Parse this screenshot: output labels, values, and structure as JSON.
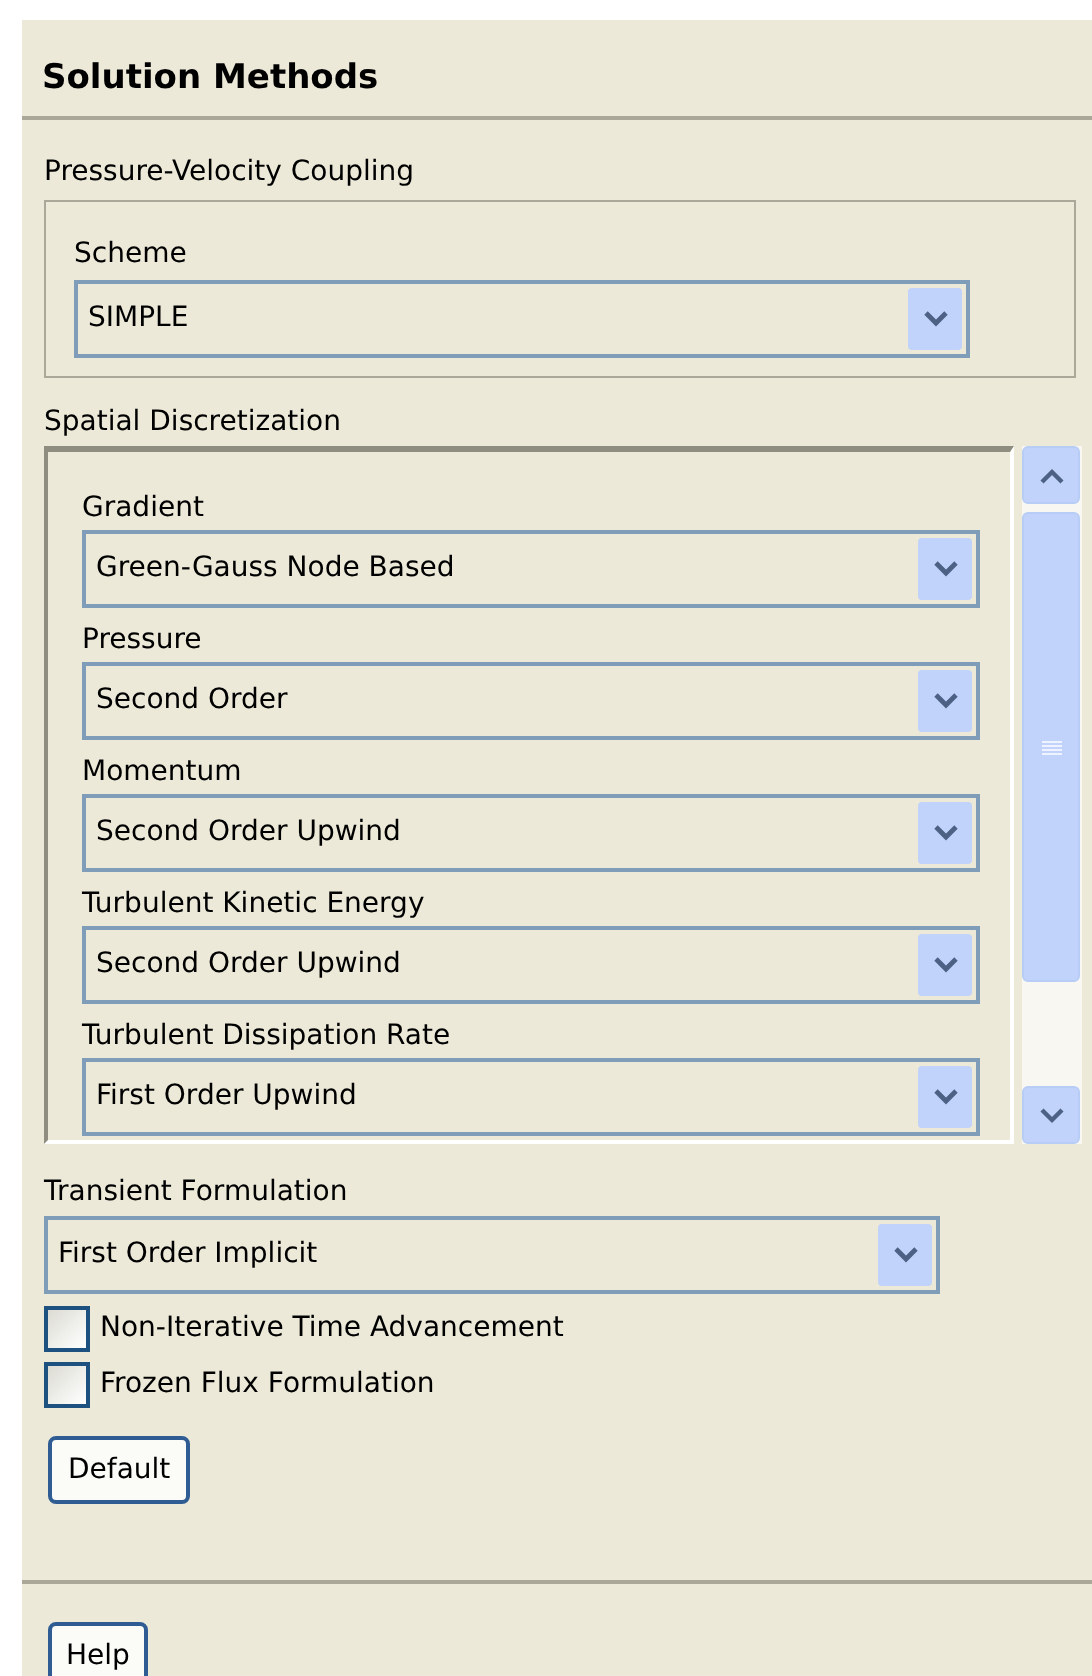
{
  "title": "Solution Methods",
  "pressure_velocity_coupling": {
    "label": "Pressure-Velocity Coupling",
    "scheme": {
      "label": "Scheme",
      "value": "SIMPLE"
    }
  },
  "spatial_discretization": {
    "label": "Spatial Discretization",
    "fields": [
      {
        "label": "Gradient",
        "value": "Green-Gauss Node Based"
      },
      {
        "label": "Pressure",
        "value": "Second Order"
      },
      {
        "label": "Momentum",
        "value": "Second Order Upwind"
      },
      {
        "label": "Turbulent Kinetic Energy",
        "value": "Second Order Upwind"
      },
      {
        "label": "Turbulent Dissipation Rate",
        "value": "First Order Upwind"
      }
    ]
  },
  "transient_formulation": {
    "label": "Transient Formulation",
    "value": "First Order Implicit"
  },
  "checkboxes": [
    {
      "label": "Non-Iterative Time Advancement",
      "checked": false
    },
    {
      "label": "Frozen Flux Formulation",
      "checked": false
    }
  ],
  "buttons": {
    "default": "Default",
    "help": "Help"
  }
}
